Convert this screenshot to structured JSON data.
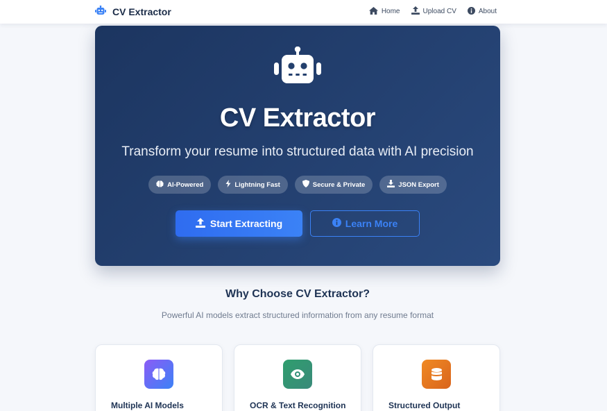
{
  "nav": {
    "brand": "CV Extractor",
    "links": [
      {
        "label": "Home",
        "icon": "home-icon"
      },
      {
        "label": "Upload CV",
        "icon": "upload-icon"
      },
      {
        "label": "About",
        "icon": "info-icon"
      }
    ]
  },
  "hero": {
    "title": "CV Extractor",
    "subtitle": "Transform your resume into structured data with AI precision",
    "badges": [
      {
        "label": "AI-Powered",
        "icon": "brain-icon"
      },
      {
        "label": "Lightning Fast",
        "icon": "bolt-icon"
      },
      {
        "label": "Secure & Private",
        "icon": "shield-icon"
      },
      {
        "label": "JSON Export",
        "icon": "download-icon"
      }
    ],
    "primary_button": "Start Extracting",
    "secondary_button": "Learn More"
  },
  "features": {
    "title": "Why Choose CV Extractor?",
    "subtitle": "Powerful AI models extract structured information from any resume format",
    "cards": [
      {
        "title": "Multiple AI Models",
        "icon": "brain-icon",
        "color_from": "#8b5cf6",
        "color_to": "#3b82f6"
      },
      {
        "title": "OCR & Text Recognition",
        "icon": "eye-icon",
        "color_from": "#2f9e6e",
        "color_to": "#3a8a7a"
      },
      {
        "title": "Structured Output",
        "icon": "database-icon",
        "color_from": "#f08a24",
        "color_to": "#d9641c"
      }
    ]
  },
  "colors": {
    "accent": "#3b82f6",
    "hero_bg_from": "#1c3560",
    "hero_bg_to": "#2a4a7e",
    "page_bg": "#f5f7fb"
  }
}
